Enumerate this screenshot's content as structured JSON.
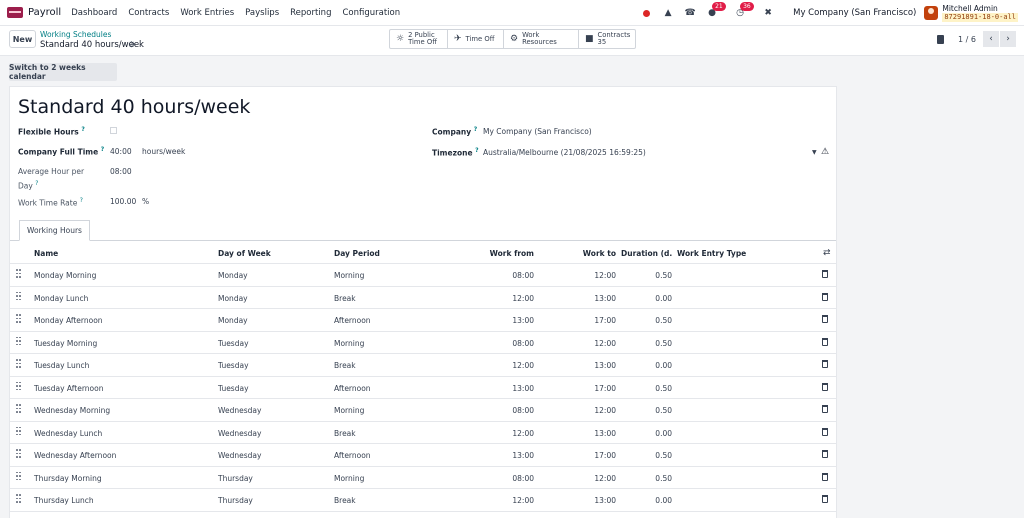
{
  "navbar": {
    "app_name": "Payroll",
    "menu": [
      "Dashboard",
      "Contracts",
      "Work Entries",
      "Payslips",
      "Reporting",
      "Configuration"
    ],
    "messages_badge": "21",
    "activities_badge": "36",
    "company": "My Company (San Francisco)",
    "user_name": "Mitchell Admin",
    "db_name": "87291891-18-0-all"
  },
  "control": {
    "new_label": "New",
    "breadcrumb_parent": "Working Schedules",
    "breadcrumb_current": "Standard 40 hours/week",
    "smart_buttons": [
      {
        "line1": "2 Public",
        "line2": "Time Off",
        "icon": "public-time-off-icon"
      },
      {
        "line1": "Time Off",
        "line2": "",
        "icon": "plane-icon"
      },
      {
        "line1": "Work Resources",
        "line2": "",
        "icon": "gears-icon"
      },
      {
        "line1": "Contracts",
        "line2": "35",
        "icon": "book-icon"
      }
    ],
    "pager": "1 / 6"
  },
  "form": {
    "switch_label": "Switch to 2 weeks calendar",
    "title": "Standard 40 hours/week",
    "flexible_hours_label": "Flexible Hours",
    "company_full_time_label": "Company Full Time",
    "company_full_time_value": "40:00",
    "company_full_time_unit": "hours/week",
    "avg_hour_label_1": "Average Hour per",
    "avg_hour_label_2": "Day",
    "avg_hour_value": "08:00",
    "work_time_rate_label": "Work Time Rate",
    "work_time_rate_value": "100.00",
    "work_time_rate_unit": "%",
    "company_label": "Company",
    "company_value": "My Company (San Francisco)",
    "timezone_label": "Timezone",
    "timezone_value": "Australia/Melbourne (21/08/2025 16:59:25)",
    "tab_label": "Working Hours",
    "help_mark": "?"
  },
  "table": {
    "headers": [
      "Name",
      "Day of Week",
      "Day Period",
      "Work from",
      "Work to",
      "Duration (d...",
      "Work Entry Type"
    ],
    "rows": [
      {
        "name": "Monday Morning",
        "day": "Monday",
        "period": "Morning",
        "from": "08:00",
        "to": "12:00",
        "duration": "0.50"
      },
      {
        "name": "Monday Lunch",
        "day": "Monday",
        "period": "Break",
        "from": "12:00",
        "to": "13:00",
        "duration": "0.00"
      },
      {
        "name": "Monday Afternoon",
        "day": "Monday",
        "period": "Afternoon",
        "from": "13:00",
        "to": "17:00",
        "duration": "0.50"
      },
      {
        "name": "Tuesday Morning",
        "day": "Tuesday",
        "period": "Morning",
        "from": "08:00",
        "to": "12:00",
        "duration": "0.50"
      },
      {
        "name": "Tuesday Lunch",
        "day": "Tuesday",
        "period": "Break",
        "from": "12:00",
        "to": "13:00",
        "duration": "0.00"
      },
      {
        "name": "Tuesday Afternoon",
        "day": "Tuesday",
        "period": "Afternoon",
        "from": "13:00",
        "to": "17:00",
        "duration": "0.50"
      },
      {
        "name": "Wednesday Morning",
        "day": "Wednesday",
        "period": "Morning",
        "from": "08:00",
        "to": "12:00",
        "duration": "0.50"
      },
      {
        "name": "Wednesday Lunch",
        "day": "Wednesday",
        "period": "Break",
        "from": "12:00",
        "to": "13:00",
        "duration": "0.00"
      },
      {
        "name": "Wednesday Afternoon",
        "day": "Wednesday",
        "period": "Afternoon",
        "from": "13:00",
        "to": "17:00",
        "duration": "0.50"
      },
      {
        "name": "Thursday Morning",
        "day": "Thursday",
        "period": "Morning",
        "from": "08:00",
        "to": "12:00",
        "duration": "0.50"
      },
      {
        "name": "Thursday Lunch",
        "day": "Thursday",
        "period": "Break",
        "from": "12:00",
        "to": "13:00",
        "duration": "0.00"
      }
    ]
  }
}
